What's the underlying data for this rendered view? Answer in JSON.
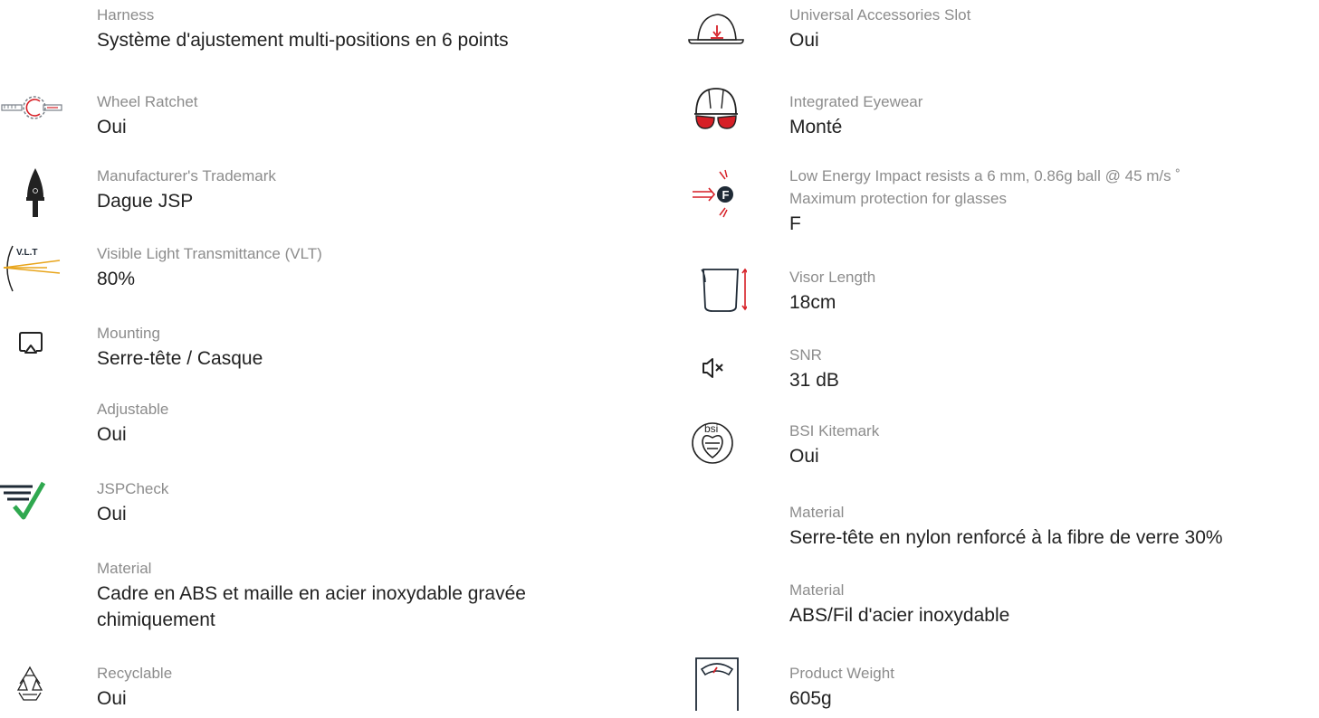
{
  "colors": {
    "label": "#8c8c8c",
    "value": "#222222",
    "accent_red": "#d61f26",
    "accent_green": "#2fa84f",
    "icon_dark": "#1f2a36",
    "vlt_yellow": "#e8a51c"
  },
  "left": [
    {
      "label": "Harness",
      "value": "Système d'ajustement multi-positions en 6 points",
      "icon": null
    },
    {
      "label": "Wheel Ratchet",
      "value": "Oui",
      "icon": "wheel-ratchet-icon"
    },
    {
      "label": "Manufacturer's Trademark",
      "value": "Dague JSP",
      "icon": "dagger-trademark-icon"
    },
    {
      "label": "Visible Light Transmittance (VLT)",
      "value": "80%",
      "icon": "vlt-icon",
      "icon_text": "V.L.T"
    },
    {
      "label": "Mounting",
      "value": "Serre-tête / Casque",
      "icon": "mounting-screen-icon"
    },
    {
      "label": "Adjustable",
      "value": "Oui",
      "icon": null
    },
    {
      "label": "JSPCheck",
      "value": "Oui",
      "icon": "jspcheck-icon"
    },
    {
      "label": "Material",
      "value": "Cadre en ABS et maille en acier inoxydable gravée chimiquement",
      "icon": null
    },
    {
      "label": "Recyclable",
      "value": "Oui",
      "icon": "recycle-icon"
    }
  ],
  "right": [
    {
      "label": "Universal Accessories Slot",
      "value": "Oui",
      "icon": "accessory-slot-helmet-icon"
    },
    {
      "label": "Integrated Eyewear",
      "value": "Monté",
      "icon": "integrated-eyewear-helmet-icon"
    },
    {
      "label": "Low Energy Impact resists a 6 mm, 0.86g ball @ 45 m/s ˚",
      "label2": "Maximum protection for glasses",
      "value": "F",
      "icon": "impact-f-icon",
      "icon_text": "F"
    },
    {
      "label": "Visor Length",
      "value": "18cm",
      "icon": "visor-length-icon"
    },
    {
      "label": "SNR",
      "value": "31 dB",
      "icon": "mute-speaker-icon"
    },
    {
      "label": "BSI Kitemark",
      "value": "Oui",
      "icon": "bsi-kitemark-icon",
      "icon_text": "bsi"
    },
    {
      "label": "Material",
      "value": "Serre-tête en nylon renforcé à la fibre de verre 30%",
      "icon": null
    },
    {
      "label": "Material",
      "value": "ABS/Fil d'acier inoxydable",
      "icon": null
    },
    {
      "label": "Product Weight",
      "value": "605g",
      "icon": "weight-scale-icon"
    }
  ]
}
